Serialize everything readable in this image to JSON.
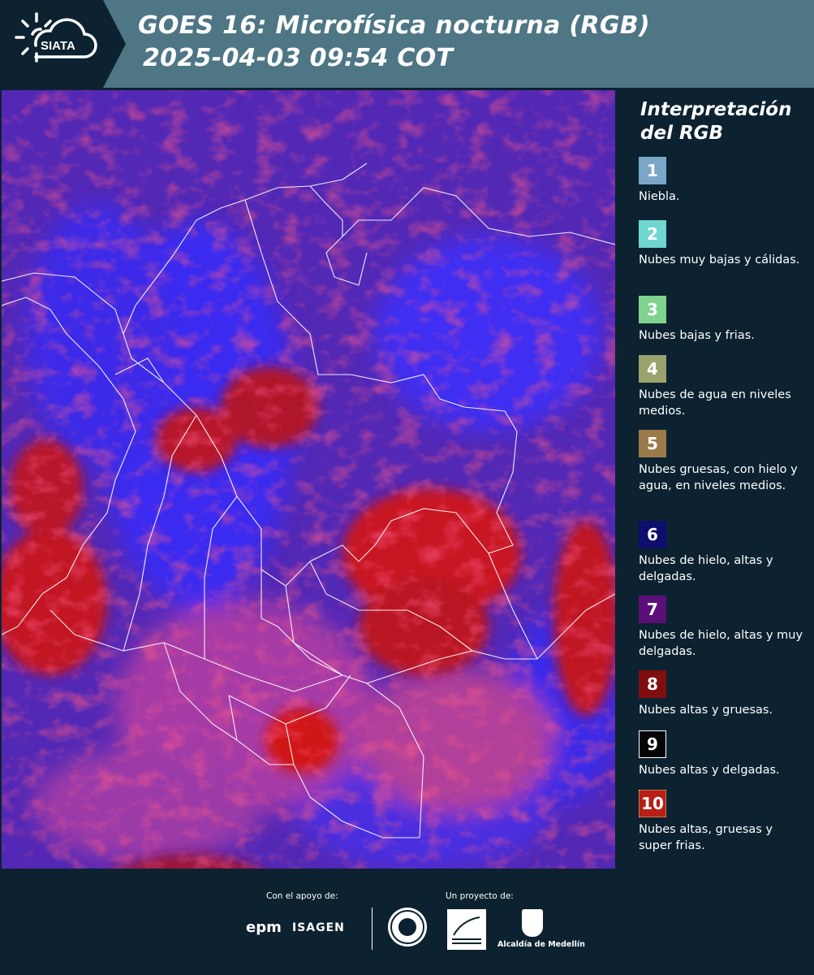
{
  "header": {
    "logo_text": "SIATA",
    "title_line1": "GOES 16: Microfísica nocturna (RGB)",
    "title_line2": "2025-04-03 09:54 COT"
  },
  "legend": {
    "title": "Interpretación del RGB",
    "items": [
      {
        "number": "1",
        "label": "Niebla.",
        "color": "#7aa6c8"
      },
      {
        "number": "2",
        "label": "Nubes muy bajas y cálidas.",
        "color": "#6fd7cf"
      },
      {
        "number": "3",
        "label": "Nubes bajas y frias.",
        "color": "#7fd38e"
      },
      {
        "number": "4",
        "label": "Nubes de agua en niveles medios.",
        "color": "#9aa36c"
      },
      {
        "number": "5",
        "label": "Nubes gruesas, con hielo y agua, en niveles medios.",
        "color": "#9b7a4a"
      },
      {
        "number": "6",
        "label": "Nubes de hielo, altas y delgadas.",
        "color": "#0d0f6e"
      },
      {
        "number": "7",
        "label": "Nubes de hielo, altas y muy delgadas.",
        "color": "#5c0f78"
      },
      {
        "number": "8",
        "label": "Nubes altas y gruesas.",
        "color": "#800e0e"
      },
      {
        "number": "9",
        "label": "Nubes altas y delgadas.",
        "color": "#050509"
      },
      {
        "number": "10",
        "label": "Nubes altas, gruesas y super frias.",
        "color": "#b51f14"
      }
    ]
  },
  "footer": {
    "support_label": "Con el apoyo de:",
    "project_label": "Un proyecto de:",
    "epm_logo": "epm",
    "isagen_logo": "ISAGEN",
    "medellin_logo": "Alcaldía de Medellín"
  }
}
